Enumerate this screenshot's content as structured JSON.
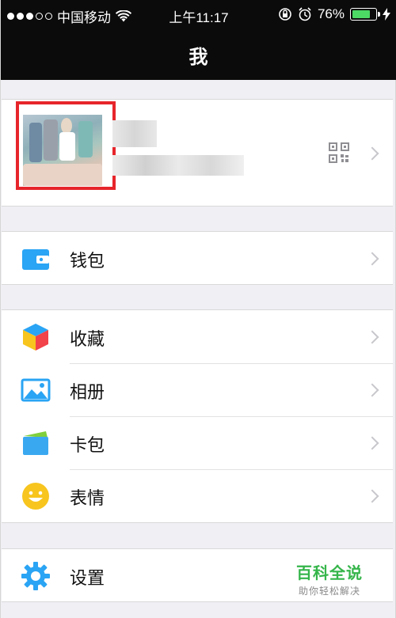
{
  "status_bar": {
    "carrier": "中国移动",
    "time": "上午11:17",
    "battery": "76%",
    "battery_level": 0.76
  },
  "nav": {
    "title": "我"
  },
  "profile": {
    "avatar_icon": "avatar-photo",
    "qr_icon": "qr-code-icon",
    "chevron_icon": "chevron-right-icon"
  },
  "menu": {
    "wallet": {
      "label": "钱包",
      "icon": "wallet-icon"
    },
    "favorites": {
      "label": "收藏",
      "icon": "cube-icon"
    },
    "album": {
      "label": "相册",
      "icon": "photo-icon"
    },
    "cards": {
      "label": "卡包",
      "icon": "card-icon"
    },
    "stickers": {
      "label": "表情",
      "icon": "smiley-icon"
    },
    "settings": {
      "label": "设置",
      "icon": "gear-icon"
    }
  },
  "watermark": {
    "brand": "百科全说",
    "sub": "助你轻松解决"
  },
  "colors": {
    "highlight_border": "#e6252b",
    "icon_blue": "#2aa4f4",
    "smiley_yellow": "#f7c51e",
    "watermark_green": "#35b54a"
  }
}
